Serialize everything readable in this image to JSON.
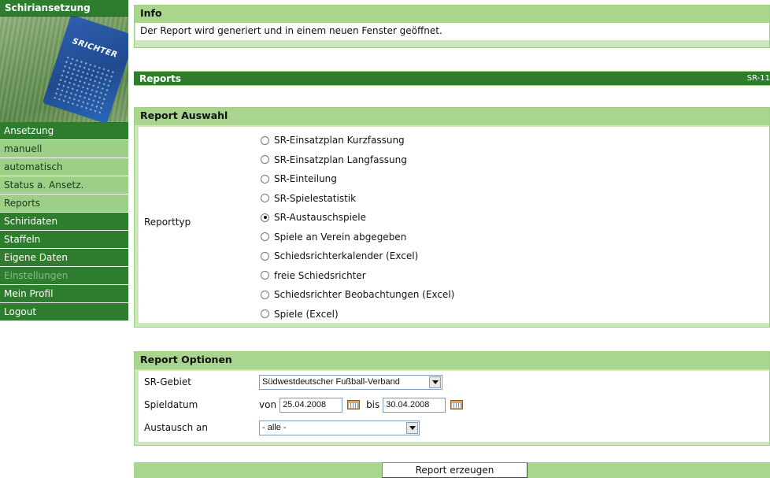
{
  "sidebar": {
    "title": "Schiriansetzung",
    "image_text": "SRICHTER",
    "items": [
      {
        "label": "Ansetzung"
      },
      {
        "label": "manuell"
      },
      {
        "label": "automatisch"
      },
      {
        "label": "Status a. Ansetz."
      },
      {
        "label": "Reports"
      },
      {
        "label": "Schiridaten"
      },
      {
        "label": "Staffeln"
      },
      {
        "label": "Eigene Daten"
      },
      {
        "label": "Einstellungen"
      },
      {
        "label": "Mein Profil"
      },
      {
        "label": "Logout"
      }
    ]
  },
  "info": {
    "title": "Info",
    "message": "Der Report wird generiert und in einem neuen Fenster geöffnet."
  },
  "reports": {
    "title": "Reports",
    "code": "SR-11"
  },
  "auswahl": {
    "title": "Report Auswahl",
    "label": "Reporttyp",
    "options": [
      {
        "label": "SR-Einsatzplan Kurzfassung",
        "selected": false
      },
      {
        "label": "SR-Einsatzplan Langfassung",
        "selected": false
      },
      {
        "label": "SR-Einteilung",
        "selected": false
      },
      {
        "label": "SR-Spielestatistik",
        "selected": false
      },
      {
        "label": "SR-Austauschspiele",
        "selected": true
      },
      {
        "label": "Spiele an Verein abgegeben",
        "selected": false
      },
      {
        "label": "Schiedsrichterkalender (Excel)",
        "selected": false
      },
      {
        "label": "freie Schiedsrichter",
        "selected": false
      },
      {
        "label": "Schiedsrichter Beobachtungen (Excel)",
        "selected": false
      },
      {
        "label": "Spiele (Excel)",
        "selected": false
      }
    ]
  },
  "optionen": {
    "title": "Report Optionen",
    "gebiet_label": "SR-Gebiet",
    "gebiet_value": "Südwestdeutscher Fußball-Verband",
    "datum_label": "Spieldatum",
    "von_label": "von",
    "von_value": "25.04.2008",
    "bis_label": "bis",
    "bis_value": "30.04.2008",
    "austausch_label": "Austausch an",
    "austausch_value": "- alle -"
  },
  "submit_label": "Report erzeugen"
}
